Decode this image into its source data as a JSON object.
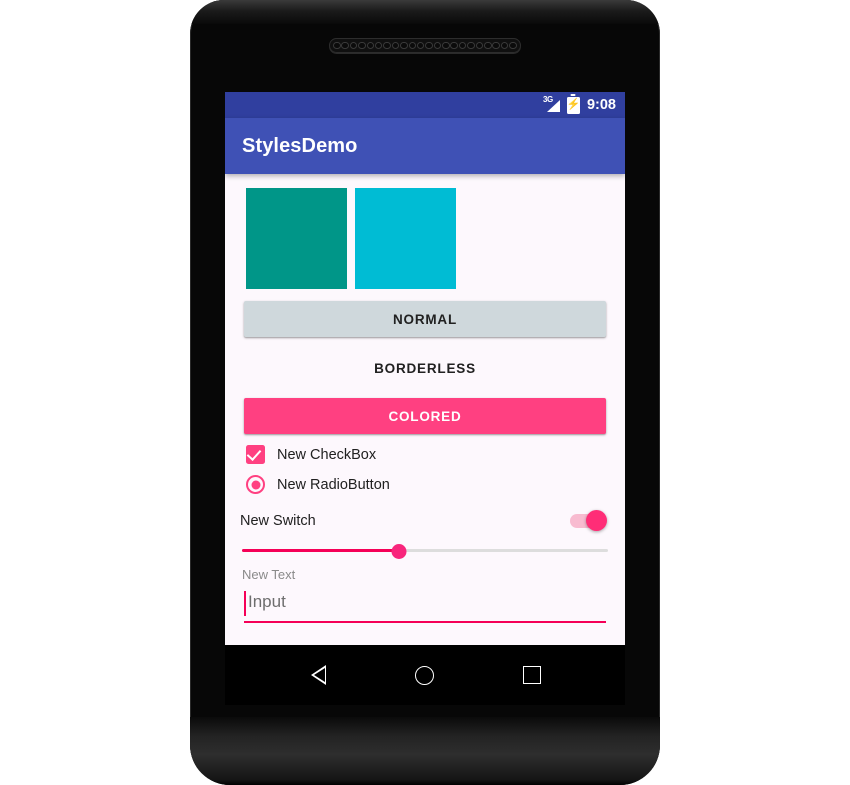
{
  "device": {
    "speaker_holes": 22
  },
  "status_bar": {
    "network_label": "3G",
    "time": "9:08",
    "background": "#303F9F"
  },
  "app_bar": {
    "title": "StylesDemo",
    "background": "#3F51B5"
  },
  "swatches": [
    {
      "name": "teal-swatch",
      "color": "#009688"
    },
    {
      "name": "cyan-swatch",
      "color": "#00BCD4"
    }
  ],
  "buttons": {
    "normal": "NORMAL",
    "borderless": "BORDERLESS",
    "colored": "COLORED",
    "normal_color": "#CFD8DC",
    "colored_color": "#FF4081"
  },
  "controls": {
    "checkbox": {
      "label": "New CheckBox",
      "checked": true,
      "color": "#FF4081"
    },
    "radio": {
      "label": "New RadioButton",
      "selected": true,
      "color": "#FF4081"
    },
    "switch": {
      "label": "New Switch",
      "on": true,
      "color": "#FF2D77"
    },
    "slider": {
      "value_percent": 43,
      "color": "#F50057"
    },
    "text_label": "New Text",
    "text_field": {
      "value": "Input",
      "placeholder": "Input",
      "underline_color": "#F50057"
    }
  },
  "nav_bar": {
    "back": "back-button",
    "home": "home-button",
    "recents": "recents-button"
  }
}
